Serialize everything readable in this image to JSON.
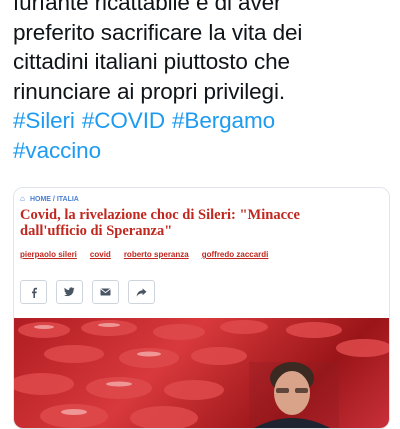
{
  "tweet": {
    "lines": [
      "furfante ricattabile e di aver",
      "preferito sacrificare la vita dei",
      "cittadini italiani piuttosto che",
      "rinunciare ai propri privilegi."
    ],
    "hashtags_line1": [
      "#Sileri",
      "#COVID",
      "#Bergamo"
    ],
    "hashtags_line2": [
      "#vaccino"
    ]
  },
  "card": {
    "breadcrumb_home": "HOME",
    "breadcrumb_sep": "/",
    "breadcrumb_section": "ITALIA",
    "headline_line1": "Covid, la rivelazione choc di Sileri: \"Minacce",
    "headline_line2": "dall'ufficio di Speranza\"",
    "tags": [
      "pierpaolo sileri",
      "covid",
      "roberto speranza",
      "goffredo zaccardi"
    ],
    "share": [
      {
        "icon": "facebook-icon"
      },
      {
        "icon": "twitter-icon"
      },
      {
        "icon": "email-icon"
      },
      {
        "icon": "share-arrow-icon"
      }
    ],
    "colors": {
      "accent": "#c0271f",
      "link": "#1d9bf0",
      "photo_red": "#c62a2f"
    }
  }
}
